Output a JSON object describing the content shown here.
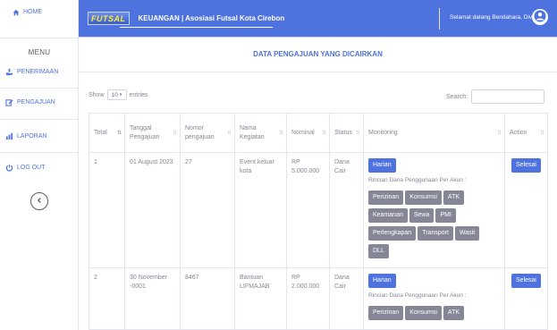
{
  "sidebar": {
    "home": "HOME",
    "menu_label": "MENU",
    "items": [
      {
        "label": "PENERIMAAN",
        "icon": "hand-coin-icon"
      },
      {
        "label": "PENGAJUAN",
        "icon": "edit-icon"
      },
      {
        "label": "LAPORAN",
        "icon": "chart-icon"
      },
      {
        "label": "LOG OUT",
        "icon": "power-icon"
      }
    ]
  },
  "topbar": {
    "logo": "FUTSAL",
    "title": "KEUANGAN | Asosiasi Futsal Kota Cirebon",
    "welcome": "Selamat datang Bendahara, Diva"
  },
  "card": {
    "title": "DATA PENGAJUAN YANG DICAIRKAN",
    "show": "Show",
    "entries_value": "10",
    "entries": "entries",
    "search_label": "Search:"
  },
  "table": {
    "headers": [
      "Total",
      "Tanggal Pengajuan",
      "Nomor pengajuan",
      "Nama Kegiatan",
      "Nominal",
      "Status",
      "Monitoring",
      "Action"
    ],
    "rows": [
      {
        "total": "1",
        "tanggal": "01 August 2023",
        "nomor": "27",
        "kegiatan": "Event keluar kota",
        "nominal": "RP 5.000.000",
        "status": "Dana Cair",
        "harian": "Harian",
        "rincian": "Rincian Dana Penggunaan Per Akun :",
        "tags": [
          "Perizinan",
          "Konsumsi",
          "ATK",
          "Keamanan",
          "Sewa",
          "PMI",
          "Perlengkapan",
          "Transport",
          "Wasit",
          "DLL"
        ],
        "action": "Selesai"
      },
      {
        "total": "2",
        "tanggal": "30 November -0001",
        "nomor": "8467",
        "kegiatan": "Bantuan LIFMAJAB",
        "nominal": "RP 2.000.000",
        "status": "Dana Cair",
        "harian": "Harian",
        "rincian": "Rincian Dana Penggunaan Per Akun :",
        "tags": [
          "Perizinan",
          "Konsumsi",
          "ATK"
        ],
        "action": "Selesai"
      }
    ]
  },
  "colors": {
    "primary": "#4e73df",
    "secondary": "#858796",
    "background": "#f4f5f8"
  }
}
